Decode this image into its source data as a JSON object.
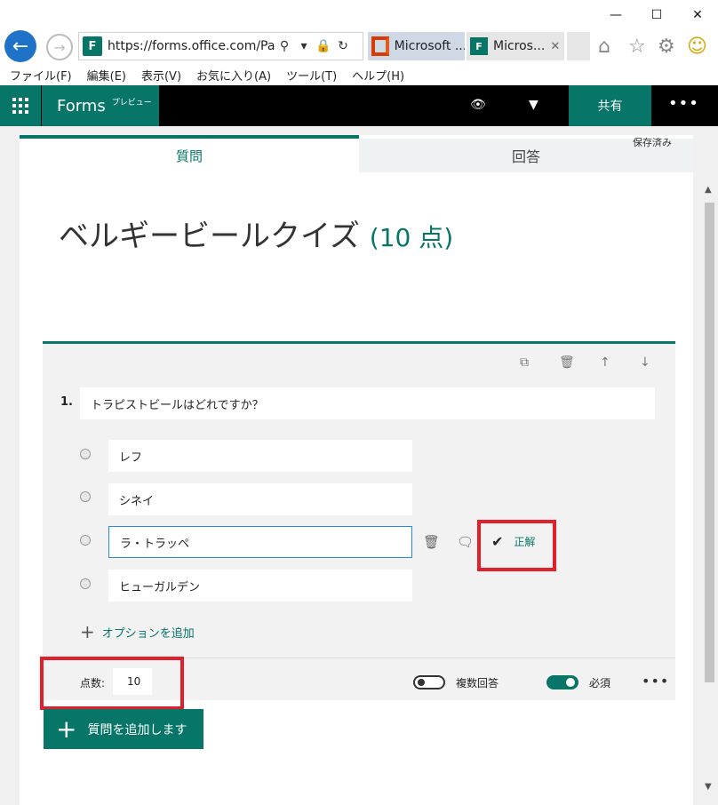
{
  "browser": {
    "url": "https://forms.office.com/Pa",
    "site_icon": "F",
    "tabs": [
      {
        "label": "Microsoft ...",
        "icon": "office-icon"
      },
      {
        "label": "Micros...",
        "icon": "forms-icon",
        "close": "✕"
      }
    ],
    "menu": [
      "ファイル(F)",
      "編集(E)",
      "表示(V)",
      "お気に入り(A)",
      "ツール(T)",
      "ヘルプ(H)"
    ]
  },
  "app": {
    "name": "Forms",
    "tag": "プレビュー",
    "share_label": "共有",
    "accent": "#077568"
  },
  "tabs": {
    "questions": "質問",
    "responses": "回答",
    "saved": "保存済み"
  },
  "quiz": {
    "title": "ベルギービールクイズ",
    "points_label": "(10 点)"
  },
  "question": {
    "number": "1.",
    "text": "トラピストビールはどれですか？",
    "options": [
      "レフ",
      "シネイ",
      "ラ・トラッペ",
      "ヒューガルデン"
    ],
    "correct_label": "正解",
    "add_option": "オプションを追加",
    "points_label": "点数:",
    "points_value": "10",
    "multiple_answers_label": "複数回答",
    "required_label": "必須"
  },
  "add_question": "質問を追加します"
}
